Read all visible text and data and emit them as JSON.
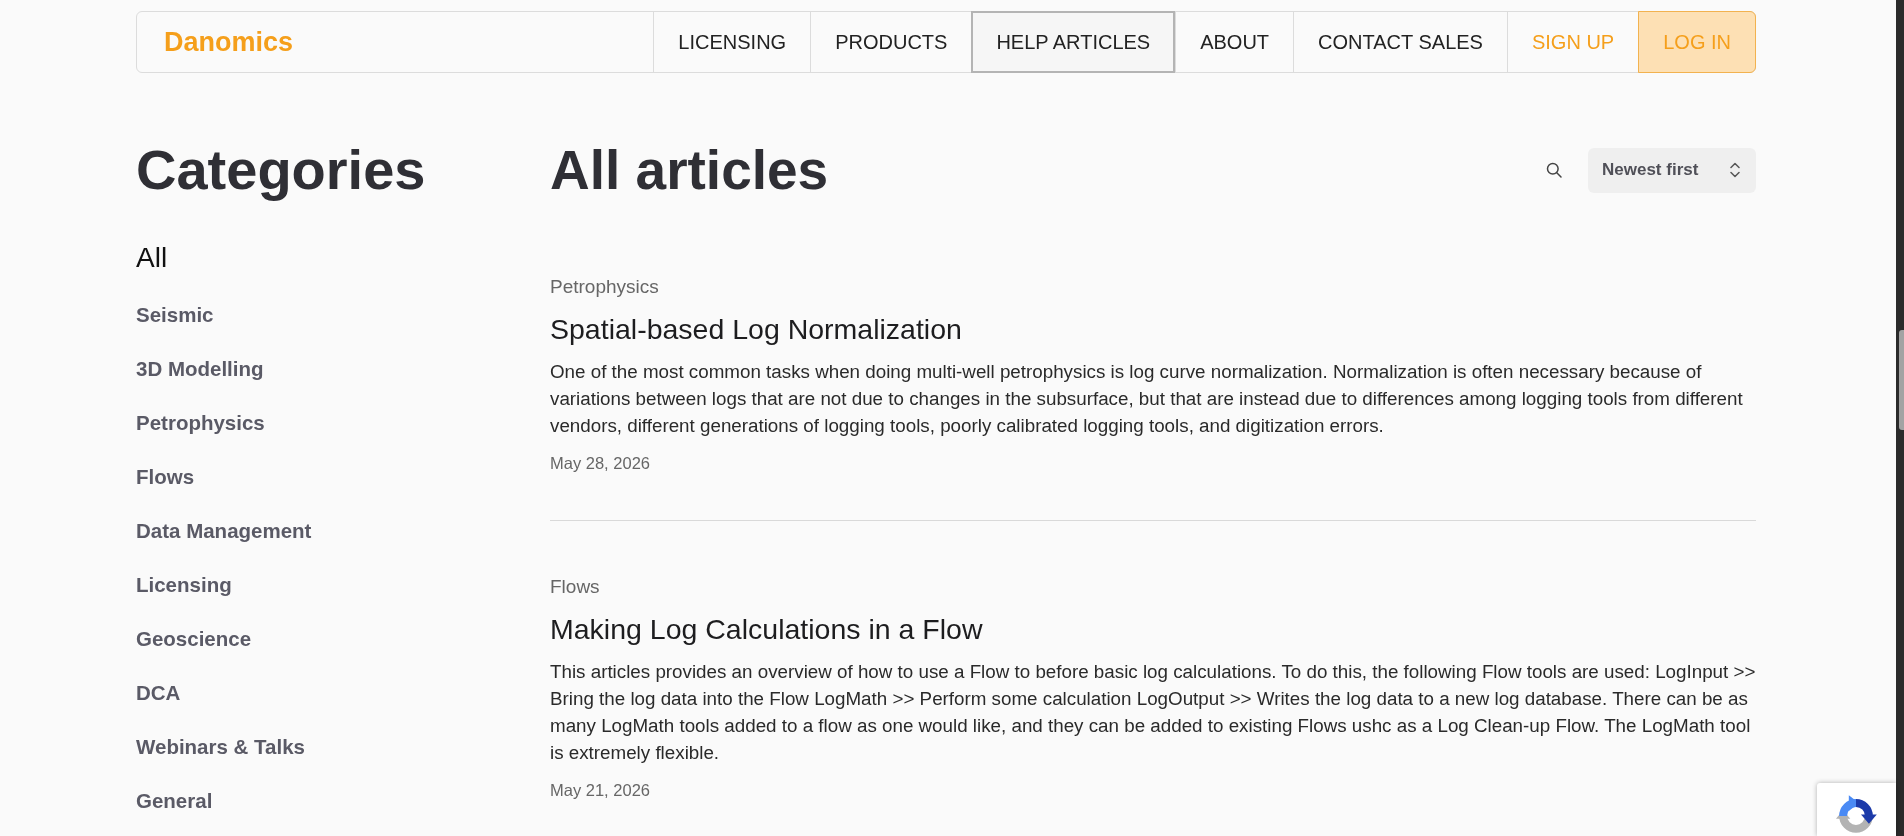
{
  "navbar": {
    "logo": "Danomics",
    "links": [
      {
        "label": "LICENSING",
        "kind": "link",
        "selected": false
      },
      {
        "label": "PRODUCTS",
        "kind": "link",
        "selected": false
      },
      {
        "label": "HELP ARTICLES",
        "kind": "link",
        "selected": true
      },
      {
        "label": "ABOUT",
        "kind": "link",
        "selected": false
      },
      {
        "label": "CONTACT SALES",
        "kind": "link",
        "selected": false
      },
      {
        "label": "SIGN UP",
        "kind": "accent",
        "selected": false
      },
      {
        "label": "LOG IN",
        "kind": "primary",
        "selected": false
      }
    ]
  },
  "sidebar": {
    "title": "Categories",
    "items": [
      {
        "label": "All",
        "selected": true
      },
      {
        "label": "Seismic",
        "selected": false
      },
      {
        "label": "3D Modelling",
        "selected": false
      },
      {
        "label": "Petrophysics",
        "selected": false
      },
      {
        "label": "Flows",
        "selected": false
      },
      {
        "label": "Data Management",
        "selected": false
      },
      {
        "label": "Licensing",
        "selected": false
      },
      {
        "label": "Geoscience",
        "selected": false
      },
      {
        "label": "DCA",
        "selected": false
      },
      {
        "label": "Webinars & Talks",
        "selected": false
      },
      {
        "label": "General",
        "selected": false
      }
    ]
  },
  "main": {
    "title": "All articles",
    "sort": {
      "value": "Newest first"
    },
    "articles": [
      {
        "category": "Petrophysics",
        "title": "Spatial-based Log Normalization",
        "summary": "One of the most common tasks when doing multi-well petrophysics is log curve normalization. Normalization is often necessary because of variations between logs that are not due to changes in the subsurface, but that are instead due to differences among logging tools from different vendors, different generations of logging tools, poorly calibrated logging tools, and digitization errors.",
        "date": "May 28, 2026"
      },
      {
        "category": "Flows",
        "title": "Making Log Calculations in a Flow",
        "summary": "This articles provides an overview of how to use a Flow to before basic log calculations. To do this, the following Flow tools are used: LogInput >> Bring the log data into the Flow LogMath >> Perform some calculation LogOutput >> Writes the log data to a new log database. There can be as many LogMath tools added to a flow as one would like, and they can be added to existing Flows ushc as a Log Clean-up Flow. The LogMath tool is extremely flexible.",
        "date": "May 21, 2026"
      }
    ]
  }
}
